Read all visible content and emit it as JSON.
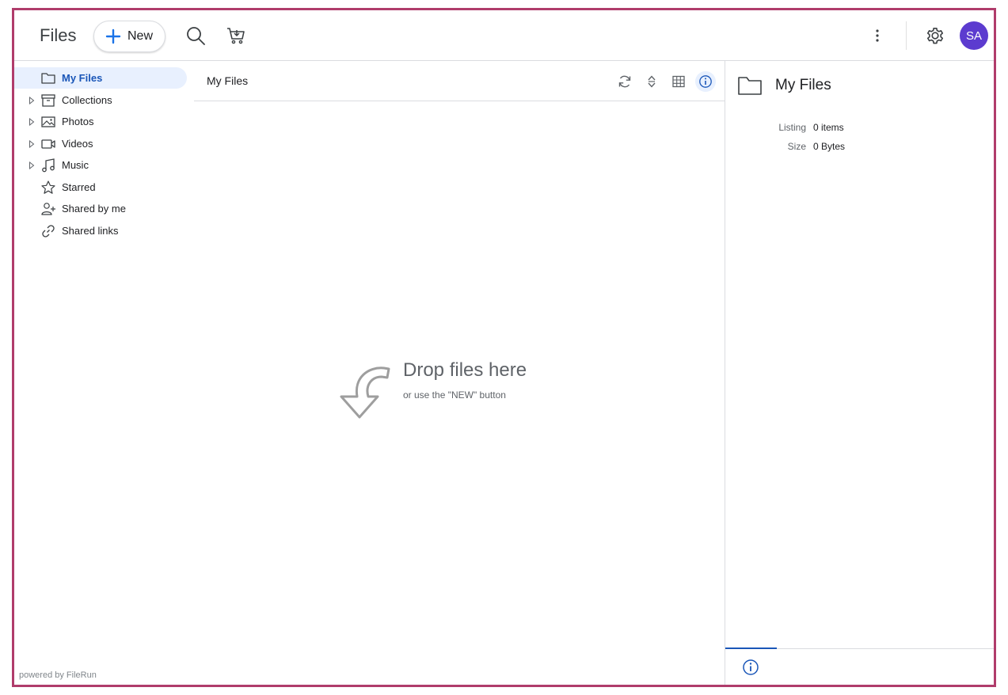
{
  "header": {
    "app_title": "Files",
    "new_button_label": "New",
    "avatar_initials": "SA",
    "icons": [
      "plus-icon",
      "search-icon",
      "cart-download-icon",
      "more-vert-icon",
      "gear-icon"
    ]
  },
  "sidebar": {
    "items": [
      {
        "label": "My Files",
        "icon": "folder-icon",
        "active": true,
        "expandable": false
      },
      {
        "label": "Collections",
        "icon": "archive-icon",
        "active": false,
        "expandable": true
      },
      {
        "label": "Photos",
        "icon": "image-icon",
        "active": false,
        "expandable": true
      },
      {
        "label": "Videos",
        "icon": "video-icon",
        "active": false,
        "expandable": true
      },
      {
        "label": "Music",
        "icon": "music-icon",
        "active": false,
        "expandable": true
      },
      {
        "label": "Starred",
        "icon": "star-icon",
        "active": false,
        "expandable": false
      },
      {
        "label": "Shared by me",
        "icon": "person-add-icon",
        "active": false,
        "expandable": false
      },
      {
        "label": "Shared links",
        "icon": "link-icon",
        "active": false,
        "expandable": false
      }
    ],
    "footer": "powered by FileRun"
  },
  "main": {
    "title": "My Files",
    "tools": [
      "refresh-icon",
      "sort-icon",
      "grid-view-icon",
      "info-icon"
    ],
    "empty": {
      "title": "Drop files here",
      "subtitle": "or use the \"NEW\" button"
    }
  },
  "info_panel": {
    "title": "My Files",
    "rows": [
      {
        "key": "Listing",
        "value": "0 items"
      },
      {
        "key": "Size",
        "value": "0 Bytes"
      }
    ]
  },
  "colors": {
    "accent": "#1a56b8",
    "active_bg": "#e8f0fe",
    "avatar_bg": "#5c3bcf",
    "frame_border": "#b03c6b"
  }
}
